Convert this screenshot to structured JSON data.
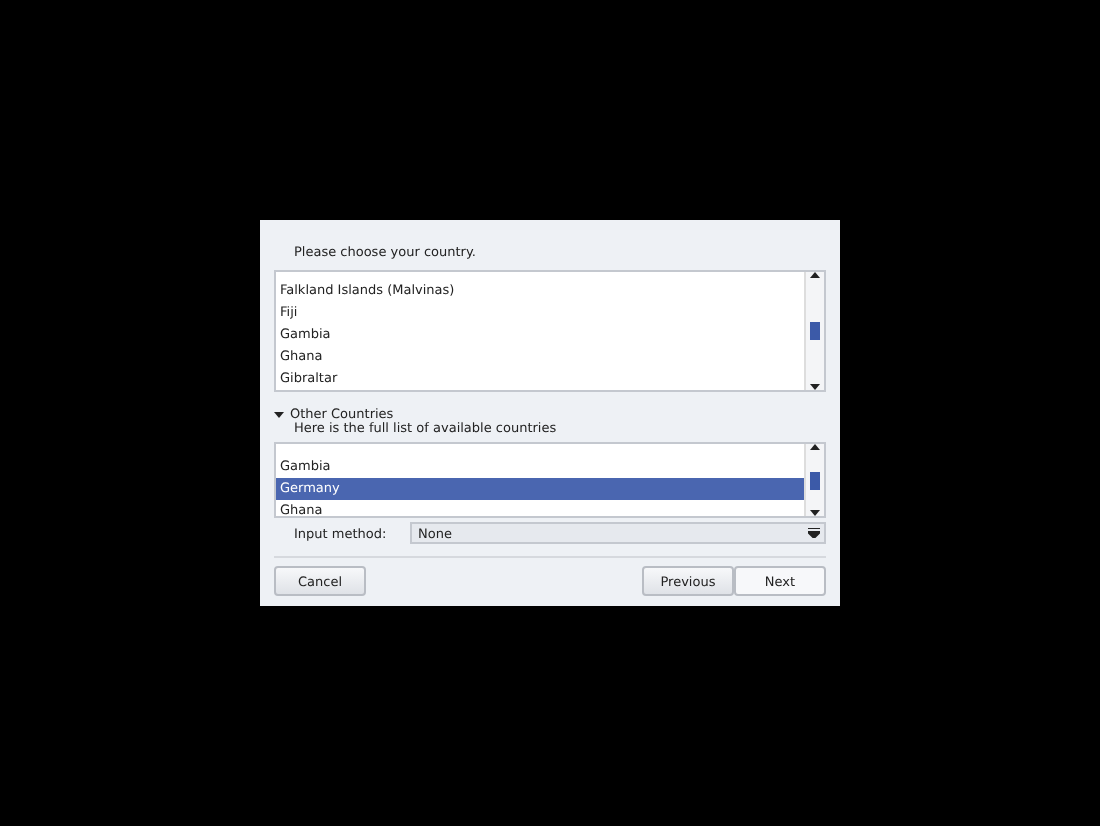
{
  "prompt": "Please choose your country.",
  "country_list": {
    "items": [
      {
        "label": "Falkland Islands (Malvinas)",
        "selected": false
      },
      {
        "label": "Fiji",
        "selected": false
      },
      {
        "label": "Gambia",
        "selected": false
      },
      {
        "label": "Ghana",
        "selected": false
      },
      {
        "label": "Gibraltar",
        "selected": false
      }
    ]
  },
  "other_countries": {
    "label": "Other Countries",
    "expanded": true,
    "subtitle": "Here is the full list of available countries",
    "items": [
      {
        "label": "Gambia",
        "selected": false
      },
      {
        "label": "Germany",
        "selected": true
      },
      {
        "label": "Ghana",
        "selected": false
      }
    ]
  },
  "input_method": {
    "label": "Input method:",
    "value": "None"
  },
  "buttons": {
    "cancel": "Cancel",
    "previous": "Previous",
    "next": "Next"
  }
}
